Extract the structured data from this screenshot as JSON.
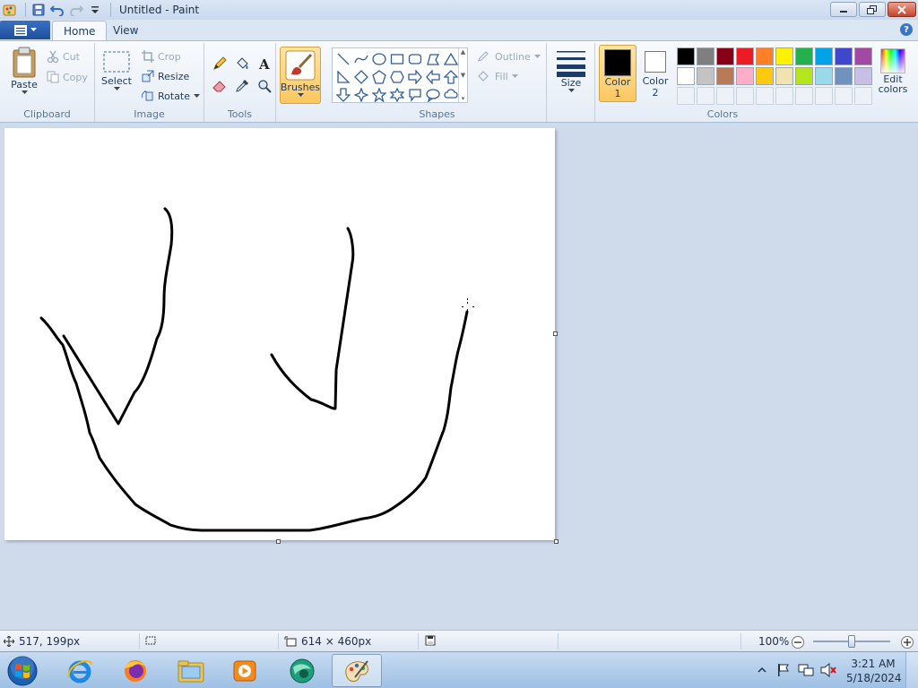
{
  "window": {
    "title": "Untitled - Paint"
  },
  "tabs": [
    {
      "label": "Home",
      "active": true
    },
    {
      "label": "View",
      "active": false
    }
  ],
  "ribbon": {
    "clipboard": {
      "label": "Clipboard",
      "paste": "Paste",
      "cut": "Cut",
      "copy": "Copy"
    },
    "image": {
      "label": "Image",
      "select": "Select",
      "crop": "Crop",
      "resize": "Resize",
      "rotate": "Rotate"
    },
    "tools": {
      "label": "Tools"
    },
    "brushes": {
      "label": "Brushes"
    },
    "shapes": {
      "label": "Shapes",
      "outline": "Outline",
      "fill": "Fill"
    },
    "size": {
      "label": "Size"
    },
    "color1": {
      "label": "Color",
      "num": "1",
      "value": "#000000"
    },
    "color2": {
      "label": "Color",
      "num": "2",
      "value": "#ffffff"
    },
    "colors": {
      "label": "Colors",
      "edit_line1": "Edit",
      "edit_line2": "colors"
    },
    "palette": [
      "#000000",
      "#7f7f7f",
      "#880015",
      "#ed1c24",
      "#ff7f27",
      "#fff200",
      "#22b14c",
      "#00a2e8",
      "#3f48cc",
      "#a349a4",
      "#ffffff",
      "#c3c3c3",
      "#b97a57",
      "#ffaec9",
      "#ffc90e",
      "#efe4b0",
      "#b5e61d",
      "#99d9ea",
      "#7092be",
      "#c8bfe7"
    ]
  },
  "status": {
    "cursor_pos": "517, 199px",
    "canvas_size": "614 × 460px",
    "zoom": "100%"
  },
  "taskbar": {
    "apps": [
      "start-orb",
      "internet-explorer",
      "firefox",
      "file-explorer",
      "media-player",
      "app-globe",
      "paint"
    ],
    "time": "3:21 AM",
    "date": "5/18/2024"
  }
}
